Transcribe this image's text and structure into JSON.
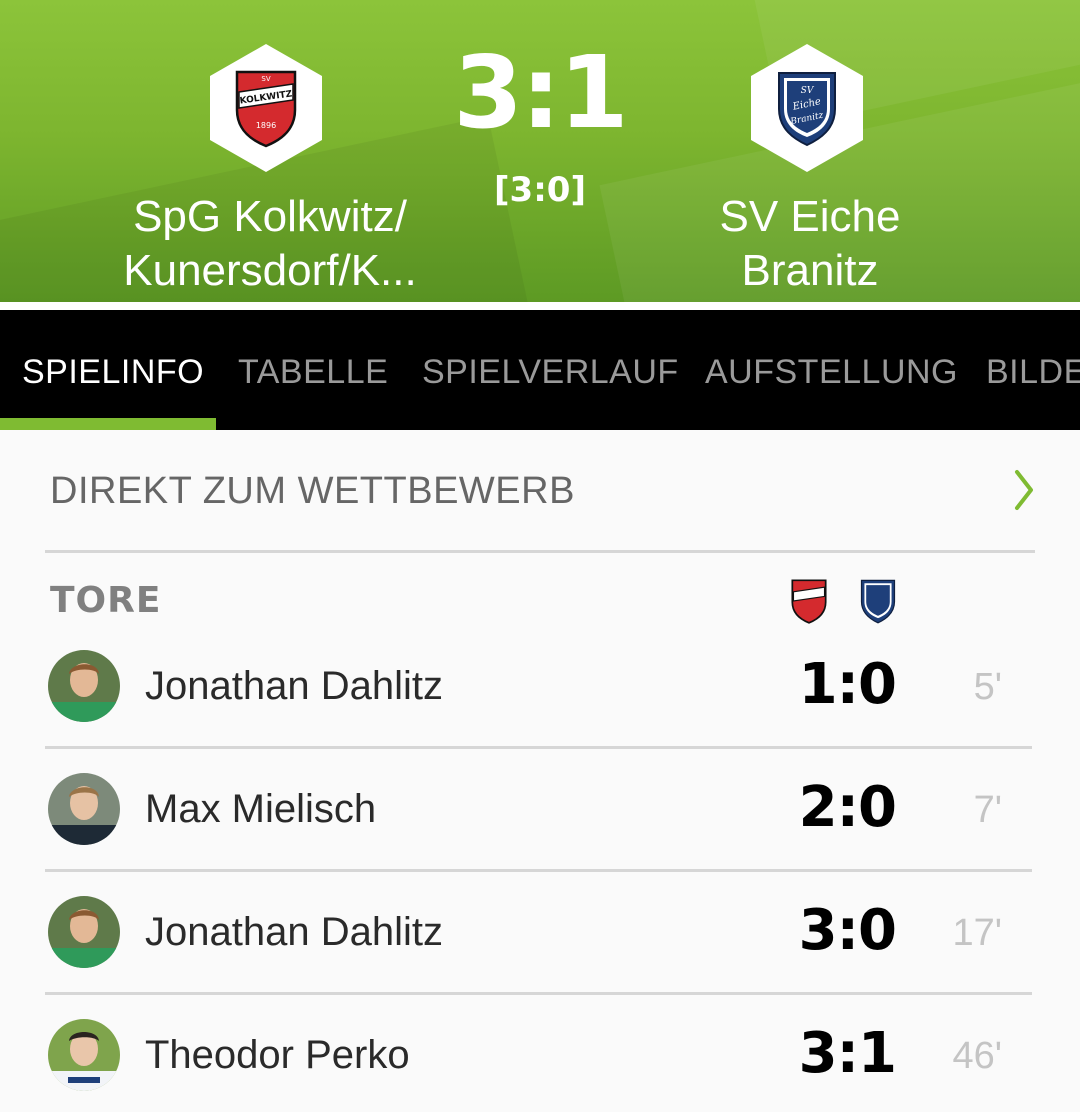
{
  "match": {
    "score": "3:1",
    "halftime": "[3:0]",
    "home_team": {
      "line1": "SpG Kolkwitz/",
      "line2": "Kunersdorf/K...",
      "crest_text": "KOLKWITZ",
      "crest_small": "SV",
      "crest_year": "1896"
    },
    "away_team": {
      "line1": "SV Eiche",
      "line2": "Branitz",
      "crest_text": "Eiche",
      "crest_text2": "Branitz",
      "crest_small": "SV"
    }
  },
  "tabs": [
    {
      "label": "SPIELINFO",
      "active": true
    },
    {
      "label": "TABELLE",
      "active": false
    },
    {
      "label": "SPIELVERLAUF",
      "active": false
    },
    {
      "label": "AUFSTELLUNG",
      "active": false
    },
    {
      "label": "BILDE",
      "active": false
    }
  ],
  "competition_link": {
    "label": "DIREKT ZUM WETTBEWERB",
    "icon": "chevron-right-icon"
  },
  "goals_section": {
    "title": "TORE",
    "goals": [
      {
        "player": "Jonathan Dahlitz",
        "score": "1:0",
        "minute": "5'"
      },
      {
        "player": "Max Mielisch",
        "score": "2:0",
        "minute": "7'"
      },
      {
        "player": "Jonathan Dahlitz",
        "score": "3:0",
        "minute": "17'"
      },
      {
        "player": "Theodor Perko",
        "score": "3:1",
        "minute": "46'"
      }
    ]
  },
  "colors": {
    "accent": "#7fbb32",
    "header_green": "#7db52f",
    "home_red": "#d42a2e",
    "away_navy": "#1e3f7a"
  }
}
